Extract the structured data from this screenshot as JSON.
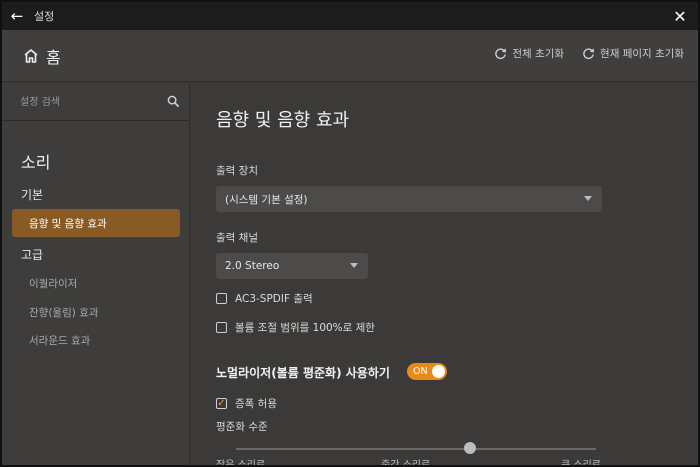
{
  "window": {
    "title": "설정"
  },
  "header": {
    "home_label": "홈",
    "reset_all": "전체 초기화",
    "reset_page": "현재 페이지 초기화"
  },
  "sidebar": {
    "search_placeholder": "설정 검색",
    "heading": "소리",
    "groups": [
      {
        "label": "기본",
        "items": [
          {
            "label": "음향 및 음향 효과",
            "active": true
          }
        ]
      },
      {
        "label": "고급",
        "items": [
          {
            "label": "이퀄라이저"
          },
          {
            "label": "잔향(울림) 효과"
          },
          {
            "label": "서라운드 효과"
          }
        ]
      }
    ]
  },
  "main": {
    "title": "음향 및 음향 효과",
    "output_device": {
      "label": "출력 장치",
      "value": "(시스템 기본 설정)"
    },
    "output_channel": {
      "label": "출력 채널",
      "value": "2.0 Stereo"
    },
    "checks": [
      {
        "label": "AC3-SPDIF 출력",
        "checked": false
      },
      {
        "label": "볼륨 조절 범위를 100%로 제한",
        "checked": false
      }
    ],
    "normalizer": {
      "title": "노멀라이저(볼륨 평준화) 사용하기",
      "toggle_label": "ON",
      "amplify_label": "증폭 허용",
      "amplify_checked": true,
      "level_label": "평준화 수준",
      "level_value": 0.65,
      "ticks": [
        "작은 소리로",
        "중간 소리로",
        "큰 소리로"
      ]
    }
  },
  "colors": {
    "accent": "#e8891a",
    "active_item": "#8a5a24"
  },
  "icons": {
    "back": "arrow-left-icon",
    "close": "close-icon",
    "home": "home-icon",
    "refresh": "refresh-icon",
    "search": "search-icon",
    "checkmark": "check-icon",
    "caret": "chevron-down-icon"
  }
}
